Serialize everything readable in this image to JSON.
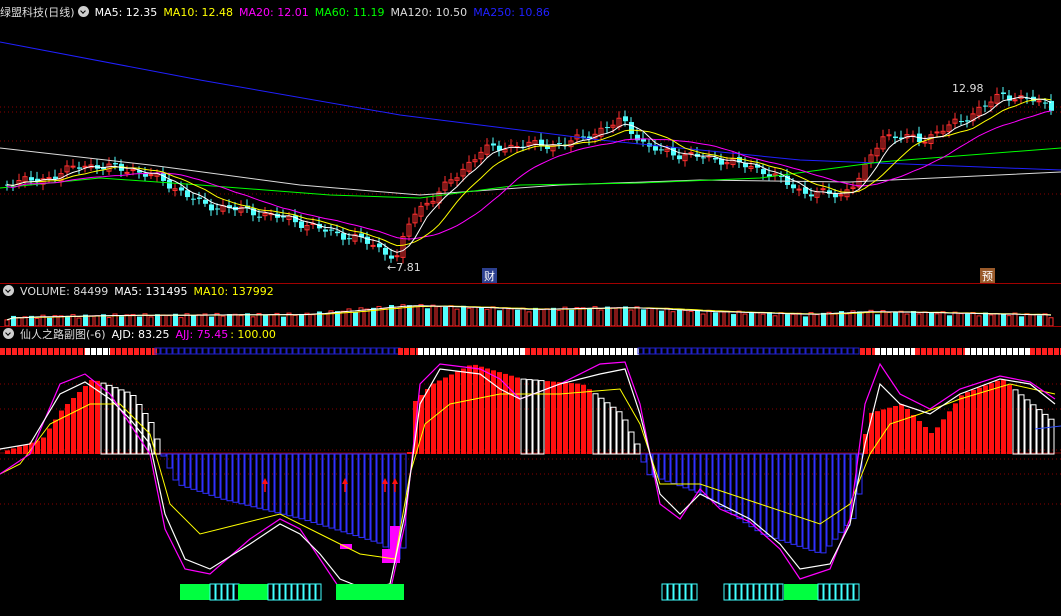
{
  "main": {
    "title": "绿盟科技(日线)",
    "ma": [
      {
        "label": "MA5: 12.35",
        "color": "#ffffff"
      },
      {
        "label": "MA10: 12.48",
        "color": "#ffff00"
      },
      {
        "label": "MA20: 12.01",
        "color": "#ff00ff"
      },
      {
        "label": "MA60: 11.19",
        "color": "#00ff00"
      },
      {
        "label": "MA120: 10.50",
        "color": "#dcdcdc"
      },
      {
        "label": "MA250: 10.86",
        "color": "#2020ff"
      }
    ],
    "high_label": "12.98",
    "low_label": "←7.81",
    "marker_cai": "财",
    "marker_yu": "预"
  },
  "volume": {
    "label": "VOLUME: 84499",
    "ma5": "MA5: 131495",
    "ma10": "MA10: 137992"
  },
  "indicator": {
    "title": "仙人之路副图(-6)",
    "ajd": "AJD: 83.25",
    "ajj": "AJJ: 75.45",
    "level": ": 100.00"
  },
  "colors": {
    "up": "#ff3030",
    "down": "#54ffff",
    "ma5": "#ffffff",
    "ma10": "#ffff00",
    "ma20": "#ff00ff",
    "ma60": "#00ff00",
    "ma120": "#dcdcdc",
    "ma250": "#2020ff"
  }
}
